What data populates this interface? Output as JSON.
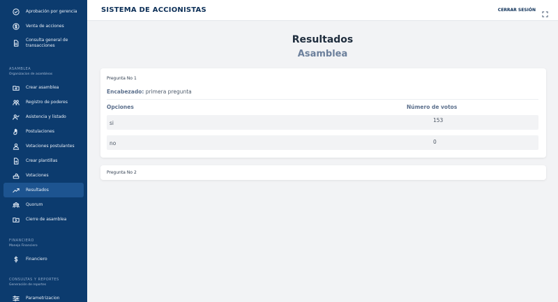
{
  "header": {
    "title": "SISTEMA DE ACCIONISTAS",
    "logout_label": "CERRAR SESIÓN"
  },
  "sidebar": {
    "top_items": [
      {
        "label": "Aprobación por gerencia",
        "icon": "check-circle-icon"
      },
      {
        "label": "Venta de acciones",
        "icon": "dollar-circle-icon"
      },
      {
        "label": "Consulta general de transacciones",
        "icon": "document-icon"
      }
    ],
    "sections": [
      {
        "title": "ASAMBLEA",
        "subtitle": "Organizacion de asambleas",
        "items": [
          {
            "label": "Crear asamblea",
            "icon": "folder-plus-icon"
          },
          {
            "label": "Registro de poderes",
            "icon": "users-icon"
          },
          {
            "label": "Asistencia y listado",
            "icon": "users-check-icon"
          },
          {
            "label": "Postulaciones",
            "icon": "hand-icon"
          },
          {
            "label": "Votaciones postulantes",
            "icon": "user-vote-icon"
          },
          {
            "label": "Crear plantillas",
            "icon": "document-plus-icon"
          },
          {
            "label": "Votaciones",
            "icon": "ballot-icon"
          },
          {
            "label": "Resultados",
            "icon": "trending-up-icon",
            "active": true
          },
          {
            "label": "Quorum",
            "icon": "group-icon"
          },
          {
            "label": "Cierre de asamblea",
            "icon": "folder-close-icon"
          }
        ]
      },
      {
        "title": "FINANCIERO",
        "subtitle": "Manejo Financiero",
        "items": [
          {
            "label": "Financiero",
            "icon": "dollar-icon"
          }
        ]
      },
      {
        "title": "CONSULTAS Y REPORTES",
        "subtitle": "Generación de reportes",
        "items": [
          {
            "label": "Parametrizacion",
            "icon": "sliders-icon"
          }
        ]
      }
    ]
  },
  "main": {
    "title": "Resultados",
    "subtitle": "Asamblea",
    "questions": [
      {
        "label": "Pregunta No 1",
        "heading_key": "Encabezado:",
        "heading_value": " primera pregunta",
        "columns": [
          "Opciones",
          "Número de votos"
        ],
        "rows": [
          {
            "option": "si",
            "votes": "153"
          },
          {
            "option": "no",
            "votes": "0"
          }
        ]
      },
      {
        "label": "Pregunta No 2"
      }
    ]
  },
  "colors": {
    "sidebar_bg": "#0c3b6e",
    "sidebar_active": "#1d5490",
    "title_color": "#0c2f57",
    "page_bg": "#f2f3f5"
  }
}
